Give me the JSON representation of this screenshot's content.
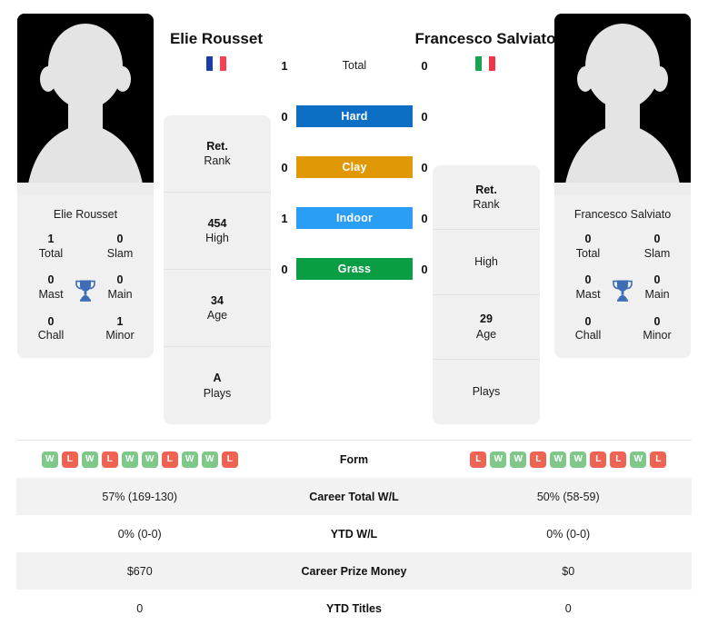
{
  "players": {
    "left": {
      "name": "Elie Rousset",
      "card_name": "Elie Rousset",
      "flag": {
        "name": "france-flag",
        "colors": [
          "#1d3ca8",
          "#ffffff",
          "#f44154"
        ]
      },
      "trophies": [
        {
          "value": "1",
          "label": "Total"
        },
        {
          "value": "0",
          "label": "Slam"
        },
        {
          "value": "0",
          "label": "Mast"
        },
        {
          "value": "0",
          "label": "Main"
        },
        {
          "value": "0",
          "label": "Chall"
        },
        {
          "value": "1",
          "label": "Minor"
        }
      ],
      "rank_card": [
        {
          "value": "Ret.",
          "label": "Rank"
        },
        {
          "value": "454",
          "label": "High"
        },
        {
          "value": "34",
          "label": "Age"
        },
        {
          "value": "A",
          "label": "Plays"
        }
      ],
      "form": [
        "W",
        "L",
        "W",
        "L",
        "W",
        "W",
        "L",
        "W",
        "W",
        "L"
      ],
      "career_total_wl": "57% (169-130)",
      "ytd_wl": "0% (0-0)",
      "career_prize_money": "$670",
      "ytd_titles": "0"
    },
    "right": {
      "name": "Francesco Salviato",
      "card_name": "Francesco Salviato",
      "flag": {
        "name": "italy-flag",
        "colors": [
          "#15a54e",
          "#ffffff",
          "#ee3648"
        ]
      },
      "trophies": [
        {
          "value": "0",
          "label": "Total"
        },
        {
          "value": "0",
          "label": "Slam"
        },
        {
          "value": "0",
          "label": "Mast"
        },
        {
          "value": "0",
          "label": "Main"
        },
        {
          "value": "0",
          "label": "Chall"
        },
        {
          "value": "0",
          "label": "Minor"
        }
      ],
      "rank_card": [
        {
          "value": "Ret.",
          "label": "Rank"
        },
        {
          "value": "",
          "label": "High"
        },
        {
          "value": "29",
          "label": "Age"
        },
        {
          "value": "",
          "label": "Plays"
        }
      ],
      "form": [
        "L",
        "W",
        "W",
        "L",
        "W",
        "W",
        "L",
        "L",
        "W",
        "L"
      ],
      "career_total_wl": "50% (58-59)",
      "ytd_wl": "0% (0-0)",
      "career_prize_money": "$0",
      "ytd_titles": "0"
    }
  },
  "surfaces": [
    {
      "label": "Total",
      "left": "1",
      "right": "0",
      "color": "",
      "styled": false
    },
    {
      "label": "Hard",
      "left": "0",
      "right": "0",
      "color": "#0d6fc4",
      "styled": true
    },
    {
      "label": "Clay",
      "left": "0",
      "right": "0",
      "color": "#e19806",
      "styled": true
    },
    {
      "label": "Indoor",
      "left": "1",
      "right": "0",
      "color": "#2a9df4",
      "styled": true
    },
    {
      "label": "Grass",
      "left": "0",
      "right": "0",
      "color": "#0a9e44",
      "styled": true
    }
  ],
  "table": {
    "rows": [
      {
        "label": "Form",
        "key": "form",
        "type": "badges"
      },
      {
        "label": "Career Total W/L",
        "key": "career_total_wl",
        "type": "text"
      },
      {
        "label": "YTD W/L",
        "key": "ytd_wl",
        "type": "text"
      },
      {
        "label": "Career Prize Money",
        "key": "career_prize_money",
        "type": "text"
      },
      {
        "label": "YTD Titles",
        "key": "ytd_titles",
        "type": "text"
      }
    ]
  }
}
